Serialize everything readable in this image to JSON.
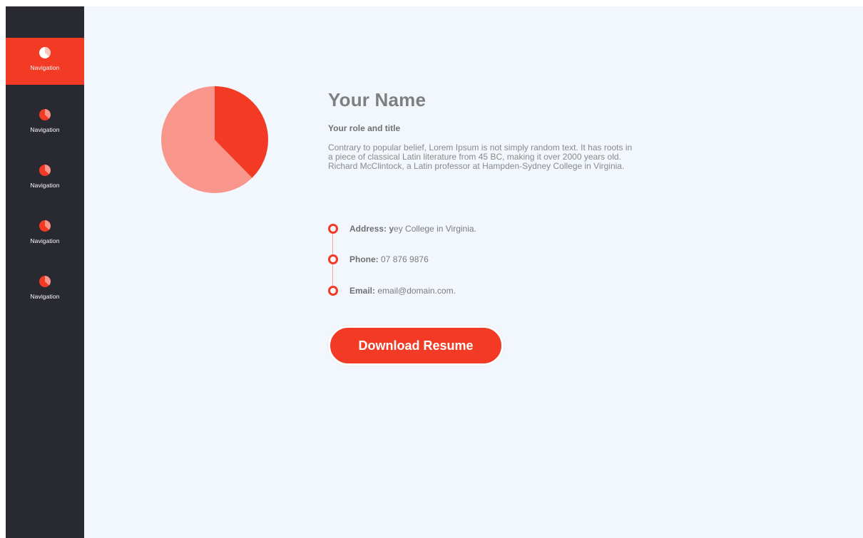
{
  "sidebar": {
    "items": [
      {
        "label": "Navigation",
        "icon": "pie-chart-icon",
        "active": true
      },
      {
        "label": "Navigation",
        "icon": "pie-chart-icon",
        "active": false
      },
      {
        "label": "Navigation",
        "icon": "pie-chart-icon",
        "active": false
      },
      {
        "label": "Navigation",
        "icon": "pie-chart-icon",
        "active": false
      },
      {
        "label": "Navigation",
        "icon": "pie-chart-icon",
        "active": false
      }
    ]
  },
  "profile": {
    "name": "Your Name",
    "role": "Your role and title",
    "bio": "Contrary to popular belief, Lorem Ipsum is not simply random text. It has roots in a piece of classical Latin literature from 45 BC, making it over 2000 years old. Richard McClintock, a Latin professor at Hampden-Sydney College in Virginia."
  },
  "contacts": {
    "address_label": "Address: y",
    "address_value": "ey College in Virginia.",
    "phone_label": "Phone:",
    "phone_value": " 07 876 9876",
    "email_label": "Email:",
    "email_value": " email@domain.com."
  },
  "actions": {
    "download_label": "Download Resume"
  },
  "colors": {
    "accent": "#f33a25",
    "accent_light": "#f8968b",
    "sidebar_bg": "#292a31",
    "main_bg": "#f1f7fd"
  }
}
